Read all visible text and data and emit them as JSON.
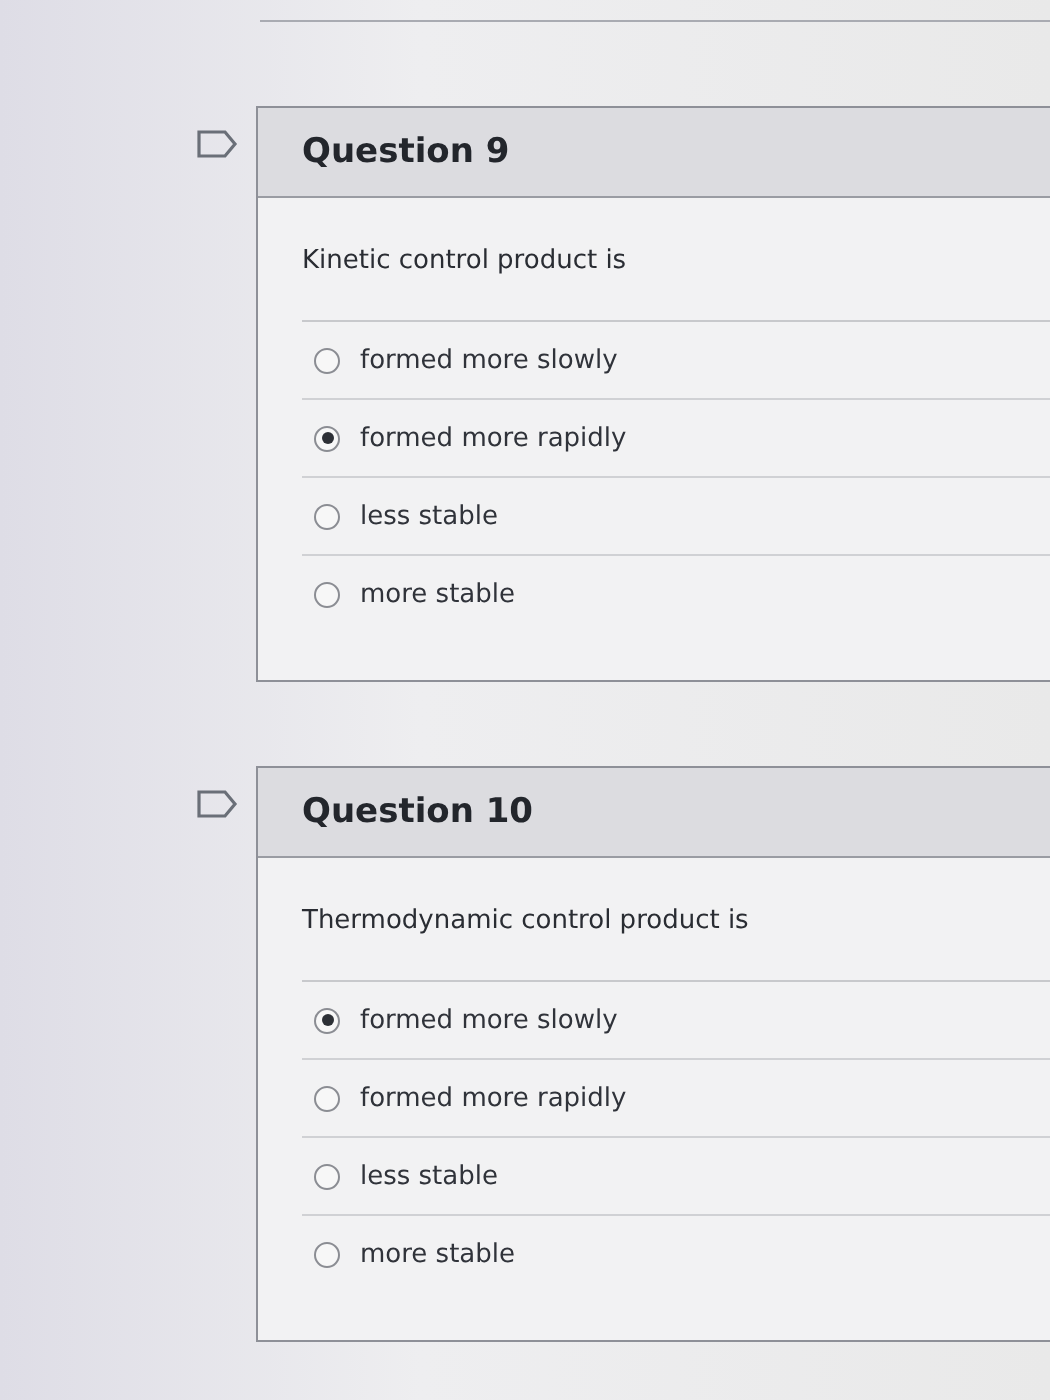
{
  "questions": [
    {
      "title": "Question 9",
      "prompt": "Kinetic control product is",
      "options": [
        {
          "label": "formed more slowly",
          "selected": false
        },
        {
          "label": "formed more rapidly",
          "selected": true
        },
        {
          "label": "less stable",
          "selected": false
        },
        {
          "label": "more stable",
          "selected": false
        }
      ]
    },
    {
      "title": "Question 10",
      "prompt": "Thermodynamic control product is",
      "options": [
        {
          "label": "formed more slowly",
          "selected": true
        },
        {
          "label": "formed more rapidly",
          "selected": false
        },
        {
          "label": "less stable",
          "selected": false
        },
        {
          "label": "more stable",
          "selected": false
        }
      ]
    }
  ]
}
